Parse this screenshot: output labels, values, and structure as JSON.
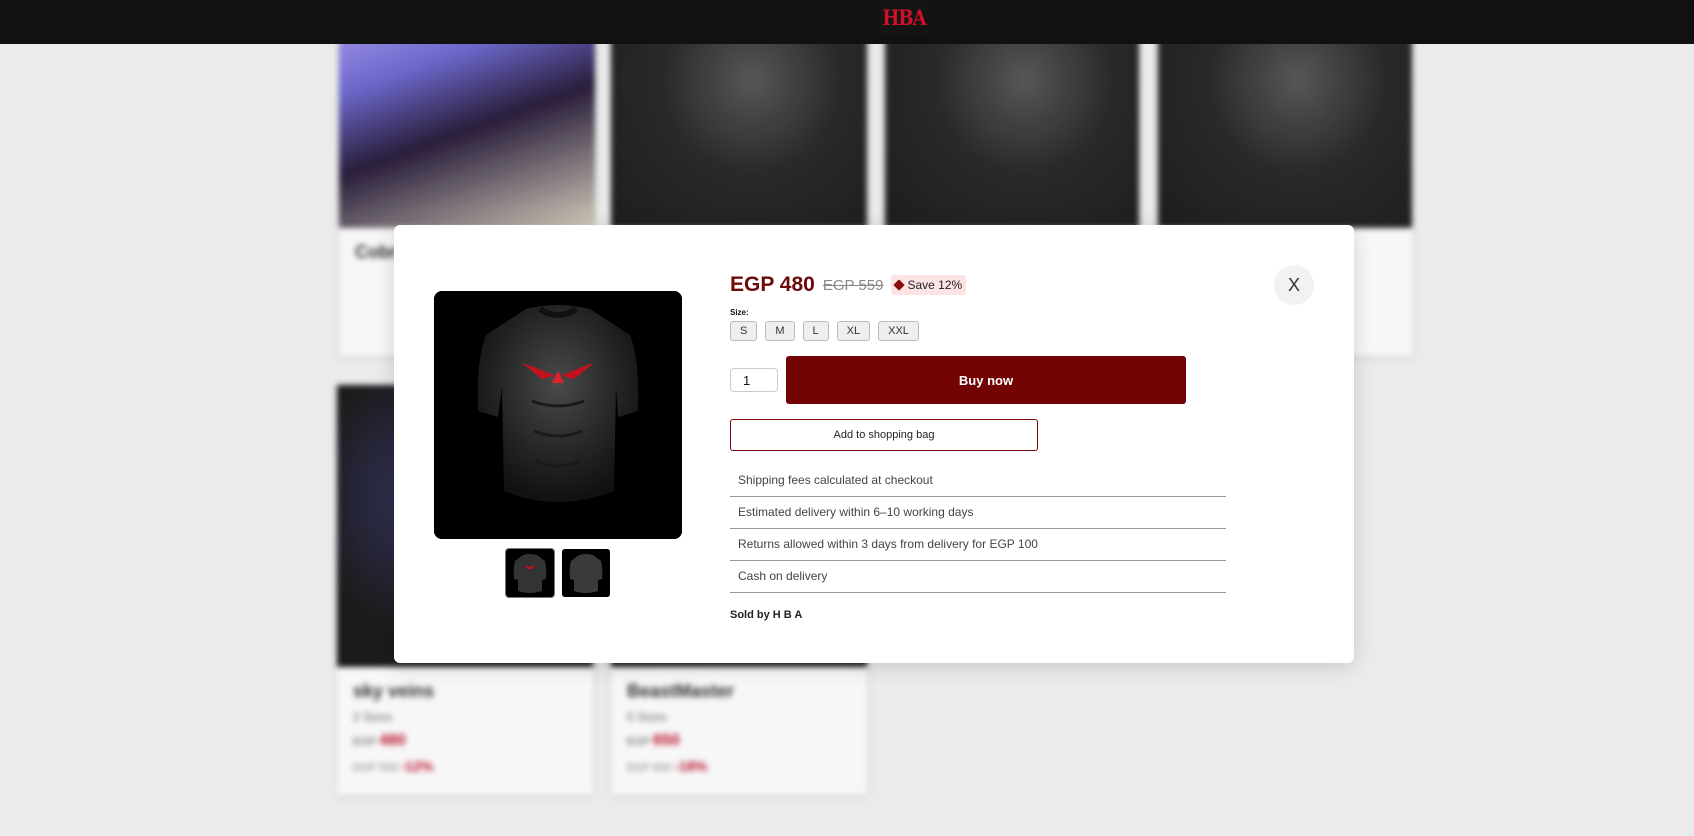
{
  "header": {
    "logo_text": "HBA"
  },
  "background_cards": [
    {
      "name": "Cobr",
      "count": "",
      "price_prefix": "",
      "price": "",
      "old_price": "",
      "discount": ""
    },
    {
      "name": "sky veins",
      "count": "2 Sizes",
      "price_prefix": "EGP",
      "price": "480",
      "old_price": "EGP 559",
      "discount": "-12%"
    },
    {
      "name": "BeastMaster",
      "count": "5 Sizes",
      "price_prefix": "EGP",
      "price": "650",
      "old_price": "EGP 800",
      "discount": "-18%"
    }
  ],
  "product": {
    "price": "EGP 480",
    "old_price": "EGP 559",
    "save_badge": "Save 12%",
    "size_label": "Size:",
    "sizes": [
      "S",
      "M",
      "L",
      "XL",
      "XXL"
    ],
    "quantity": "1",
    "buy_now": "Buy now",
    "add_to_bag": "Add to shopping bag",
    "info": [
      "Shipping fees calculated at checkout",
      "Estimated delivery within 6–10 working days",
      "Returns allowed within 3 days from delivery for EGP 100",
      "Cash on delivery"
    ],
    "seller": "Sold by H B A"
  },
  "modal": {
    "close_label": "X"
  },
  "colors": {
    "accent": "#730404",
    "price": "#6d0a0a",
    "save_bg": "#fde3e3",
    "logo": "#d0102a"
  },
  "icons": {
    "save_badge_icon": "tag-icon"
  }
}
